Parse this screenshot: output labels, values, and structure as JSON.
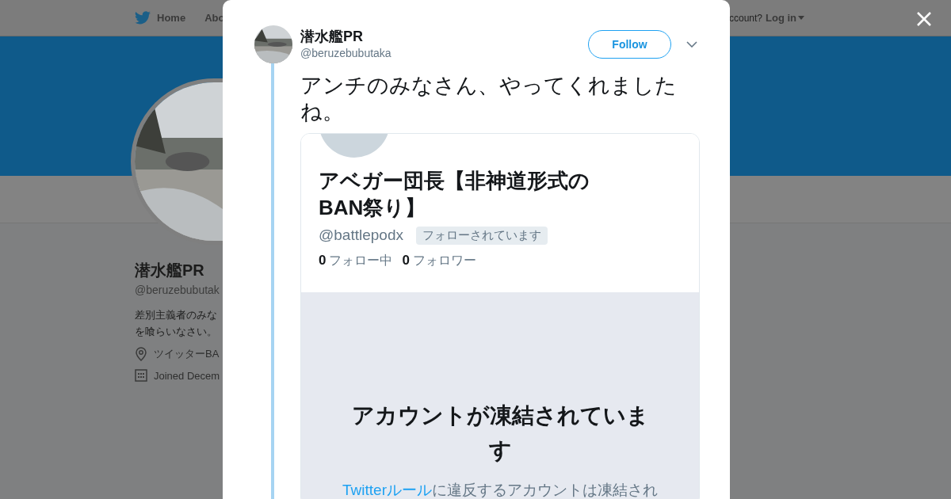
{
  "background_page": {
    "nav": {
      "items": [
        {
          "label": "Home",
          "kind": "home"
        },
        {
          "label": "Abo",
          "kind": "plain"
        }
      ],
      "account_prompt": "ccount?",
      "login": "Log in"
    },
    "profile": {
      "name": "潜水艦PR",
      "handle": "@beruzebubutak",
      "bio": [
        "差別主義者のみな",
        "を喰らいなさい。"
      ],
      "location": "ツイッターBA",
      "joined": "Joined Decem"
    }
  },
  "tweet": {
    "author": {
      "name": "潜水艦PR",
      "handle": "@beruzebubutaka"
    },
    "follow_button": "Follow",
    "text": "アンチのみなさん、やってくれましたね。",
    "embedded_screenshot": {
      "name": "アベガー団長【非神道形式のBAN祭り】",
      "handle": "@battlepodx",
      "follows_you_badge": "フォローされています",
      "following_count": "0",
      "following_label": "フォロー中",
      "followers_count": "0",
      "followers_label": "フォロワー",
      "suspended_title": "アカウントが凍結されています",
      "notice_link": "Twitterルール",
      "notice_text": "に違反するアカウントは凍結され"
    }
  }
}
